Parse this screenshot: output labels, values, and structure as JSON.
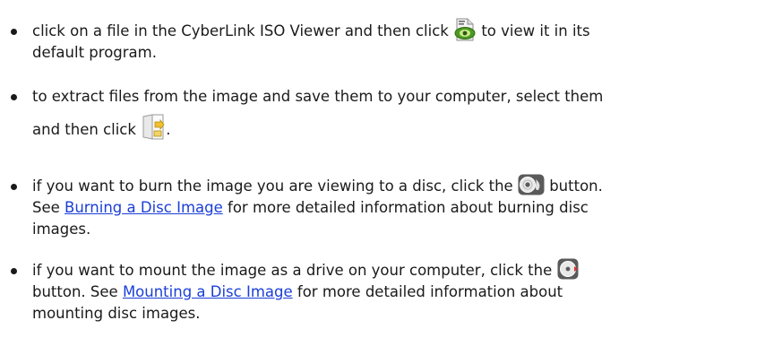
{
  "bullets": [
    {
      "before": "click on a file in the CyberLink ISO Viewer and then click ",
      "after": " to view it in its",
      "line2": "default program.",
      "icon": "view-file-icon"
    },
    {
      "line1": "to extract files from the image and save them to your computer, select them",
      "before": "and then click ",
      "after": ".",
      "icon": "extract-files-icon"
    },
    {
      "before": "if you want to burn the image you are viewing to a disc, click the ",
      "after": " button.",
      "line2_before": "See ",
      "link": "Burning a Disc Image",
      "line2_after": " for more detailed information about burning disc",
      "line3": "images.",
      "icon": "burn-disc-icon"
    },
    {
      "before": "if you want to mount the image as a drive on your computer, click the ",
      "line2_before": "button. See ",
      "link": "Mounting a Disc Image",
      "line2_after": " for more detailed information about",
      "line3": "mounting disc images.",
      "icon": "mount-disc-icon"
    }
  ],
  "colors": {
    "text": "#1a1a1a",
    "link": "#1a3fd6"
  }
}
